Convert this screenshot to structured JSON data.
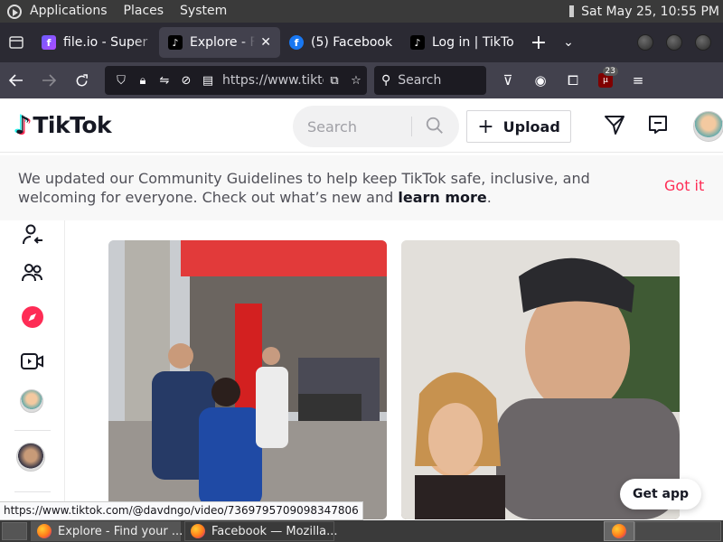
{
  "panel": {
    "menus": [
      "Applications",
      "Places",
      "System"
    ],
    "clock": "Sat May 25, 10:55 PM"
  },
  "tabs": [
    {
      "title": "file.io - Super s",
      "favicon": "fileio-icon",
      "active": false
    },
    {
      "title": "Explore - Find",
      "favicon": "tiktok-icon",
      "active": true
    },
    {
      "title": "(5) Facebook",
      "favicon": "facebook-icon",
      "active": false
    },
    {
      "title": "Log in | TikTok",
      "favicon": "tiktok-icon",
      "active": false
    }
  ],
  "navbar": {
    "url": "https://www.tiktok.com",
    "search_placeholder": "Search",
    "extension_badge": "23"
  },
  "tiktok": {
    "logo_text": "TikTok",
    "search_placeholder": "Search",
    "upload_label": "Upload",
    "notice_text_1": "We updated our Community Guidelines to help keep TikTok safe, inclusive, and welcoming for everyone. Check out what’s new and ",
    "notice_link": "learn more",
    "notice_text_2": ".",
    "got_it": "Got it",
    "get_app": "Get app"
  },
  "status_url": "https://www.tiktok.com/@davdngo/video/7369795709098347806",
  "taskbar": {
    "tasks": [
      "Explore - Find your ...",
      "Facebook — Mozilla..."
    ]
  },
  "colors": {
    "tiktok_red": "#fe2c55",
    "tiktok_cyan": "#25f4ee",
    "firefox_dark": "#2b2a33"
  }
}
